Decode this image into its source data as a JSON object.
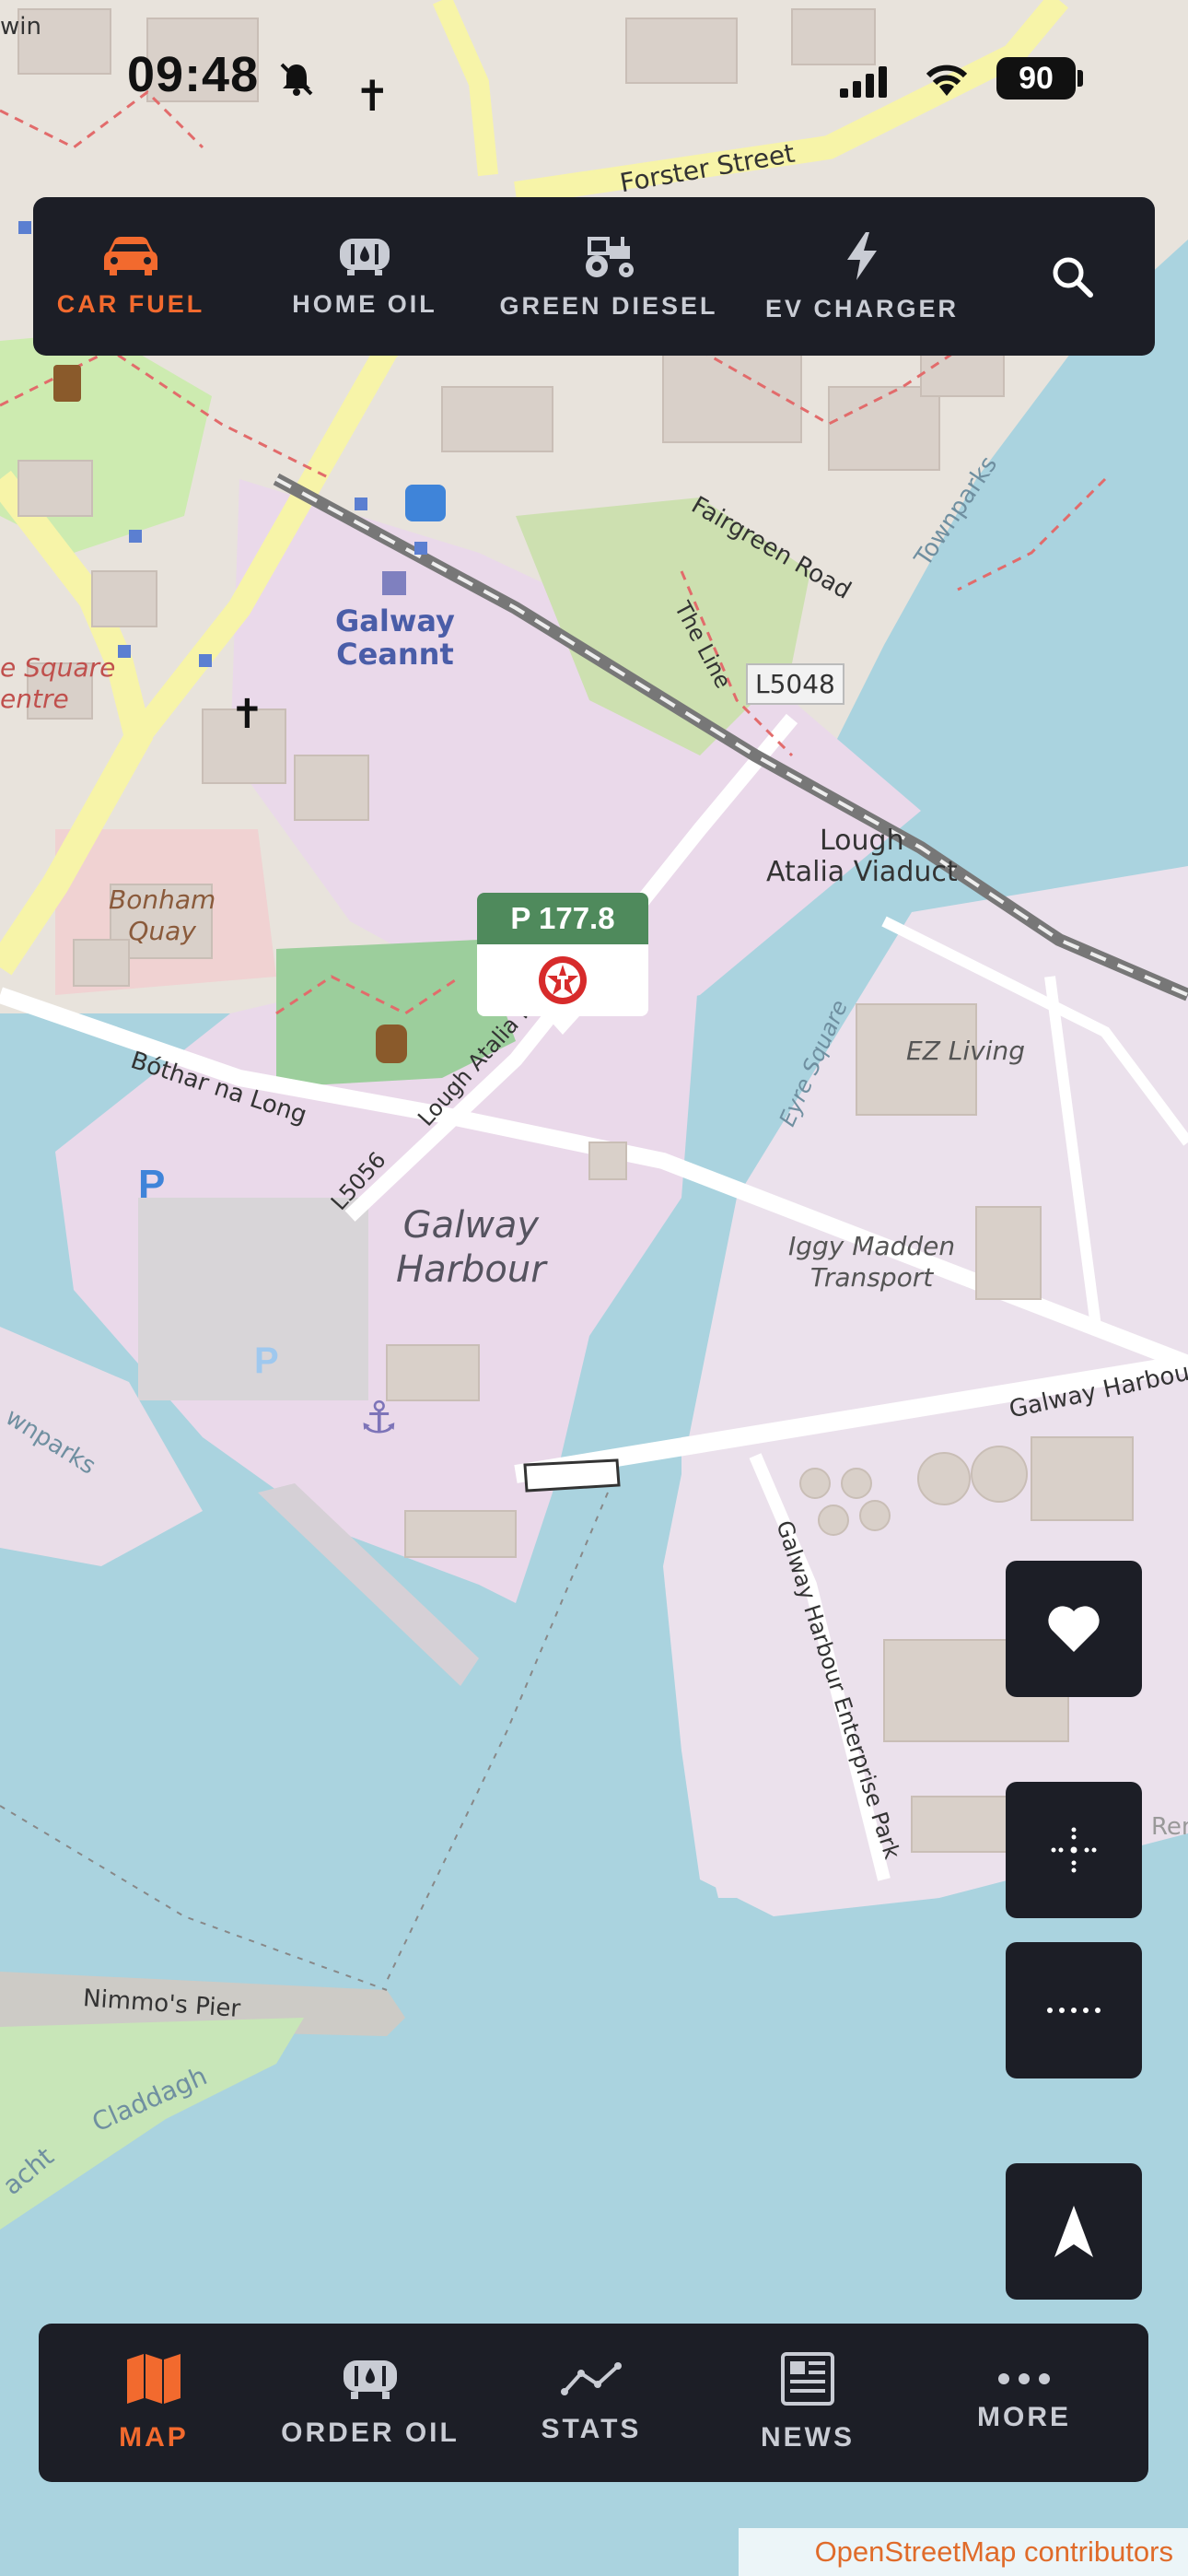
{
  "status_bar": {
    "time": "09:48",
    "battery": "90"
  },
  "top_nav": {
    "tabs": [
      {
        "label": "CAR FUEL",
        "icon": "car-icon",
        "active": true
      },
      {
        "label": "HOME OIL",
        "icon": "oil-tank-icon",
        "active": false
      },
      {
        "label": "GREEN DIESEL",
        "icon": "tractor-icon",
        "active": false
      },
      {
        "label": "EV CHARGER",
        "icon": "lightning-icon",
        "active": false
      }
    ],
    "search_icon": "search-icon"
  },
  "map": {
    "labels": {
      "forster_street": "Forster Street",
      "fairgreen_road": "Fairgreen Road",
      "townparks": "Townparks",
      "the_line": "The Line",
      "road_l5048": "L5048",
      "galway_ceannt_1": "Galway",
      "galway_ceannt_2": "Ceannt",
      "lough_atalia_viaduct_1": "Lough",
      "lough_atalia_viaduct_2": "Atalia Viaduct",
      "bonham_quay_1": "Bonham",
      "bonham_quay_2": "Quay",
      "bothar_na_long": "Bóthar na Long",
      "lough_atalia_road": "Lough Atalia R",
      "road_l5056": "L5056",
      "galway_harbour_1": "Galway",
      "galway_harbour_2": "Harbour",
      "eyre_square_sm": "Eyre Square",
      "ez_living": "EZ Living",
      "iggy_madden_1": "Iggy Madden",
      "iggy_madden_2": "Transport",
      "galway_harbour_road": "Galway Harbour",
      "enterprise_park": "Galway Harbour Enterprise Park",
      "nimmos_pier": "Nimmo's Pier",
      "claddagh": "Claddagh",
      "townparks_2": "wnparks",
      "square_centre_1": "e Square",
      "square_centre_2": "entre",
      "win": "win",
      "acht": "acht",
      "ren": "Ren"
    },
    "station_marker": {
      "price": "P 177.8",
      "brand_icon": "texaco-star-icon"
    }
  },
  "side_buttons": {
    "favourite": "heart-icon",
    "center": "crosshair-icon",
    "options": "dots-icon",
    "navigate": "navigation-arrow-icon"
  },
  "bottom_nav": {
    "tabs": [
      {
        "label": "MAP",
        "icon": "map-icon",
        "active": true
      },
      {
        "label": "ORDER OIL",
        "icon": "oil-tank-icon",
        "active": false
      },
      {
        "label": "STATS",
        "icon": "stats-line-icon",
        "active": false
      },
      {
        "label": "NEWS",
        "icon": "newspaper-icon",
        "active": false
      },
      {
        "label": "MORE",
        "icon": "more-icon",
        "active": false
      }
    ]
  },
  "attribution": "OpenStreetMap contributors",
  "colors": {
    "accent": "#f26a2e",
    "bar": "#1c1e26",
    "water": "#aad3df",
    "land": "#ede6ee",
    "price_bg": "#4f8a5c"
  }
}
